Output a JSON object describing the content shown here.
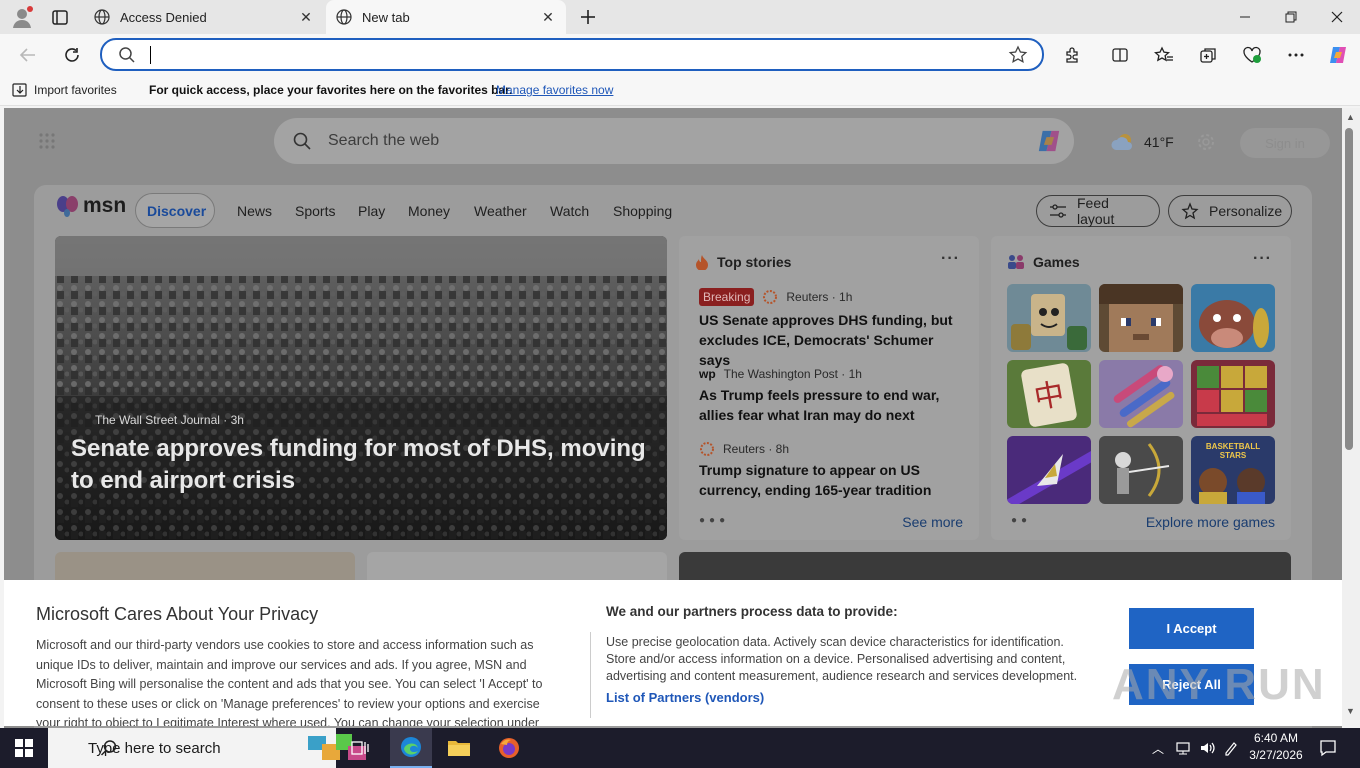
{
  "browser": {
    "tabs": [
      {
        "title": "Access Denied"
      },
      {
        "title": "New tab"
      }
    ],
    "address_value": "",
    "favorites_bar": {
      "import_label": "Import favorites",
      "message": "For quick access, place your favorites here on the favorites bar.",
      "manage_link": "Manage favorites now"
    }
  },
  "newtab": {
    "search_placeholder": "Search the web",
    "weather": "41°F",
    "sign_in": "Sign in",
    "logo": "msn",
    "nav": [
      "Discover",
      "News",
      "Sports",
      "Play",
      "Money",
      "Weather",
      "Watch",
      "Shopping"
    ],
    "feed_layout_label": "Feed layout",
    "personalize_label": "Personalize",
    "hero": {
      "source": "The Wall Street Journal · 3h",
      "title": "Senate approves funding for most of DHS, moving to end airport crisis"
    },
    "top_stories": {
      "title": "Top stories",
      "stories": [
        {
          "badge": "Breaking",
          "source": "Reuters · 1h",
          "title": "US Senate approves DHS funding, but excludes ICE, Democrats' Schumer says"
        },
        {
          "source": "The Washington Post · 1h",
          "title": "As Trump feels pressure to end war, allies fear what Iran may do next"
        },
        {
          "source": "Reuters · 8h",
          "title": "Trump signature to appear on US currency, ending 165-year tradition"
        }
      ],
      "see_more": "See more"
    },
    "games": {
      "title": "Games",
      "explore": "Explore more games",
      "tile_labels": {
        "basketball": "BASKETBALL STARS"
      }
    }
  },
  "privacy": {
    "title": "Microsoft Cares About Your Privacy",
    "body": "Microsoft and our third-party vendors use cookies to store and access information such as unique IDs to deliver, maintain and improve our services and ads. If you agree, MSN and Microsoft Bing will personalise the content and ads that you see. You can select 'I Accept' to consent to these uses or click on 'Manage preferences' to review your options and exercise your right to object to Legitimate Interest where used.  You can change your selection under",
    "partners_title": "We and our partners process data to provide:",
    "partners_body": "Use precise geolocation data. Actively scan device characteristics for identification. Store and/or access information on a device. Personalised advertising and content, advertising and content measurement, audience research and services development.",
    "partners_link": "List of Partners (vendors)",
    "accept": "I Accept",
    "reject": "Reject All"
  },
  "watermark": "ANY RUN",
  "taskbar": {
    "search_placeholder": "Type here to search",
    "time": "6:40 AM",
    "date": "3/27/2026"
  },
  "colors": {
    "accent": "#1f64c4",
    "address_border": "#1f5fbf",
    "breaking": "#8a1f1f",
    "taskbar": "#1c1c2b"
  }
}
